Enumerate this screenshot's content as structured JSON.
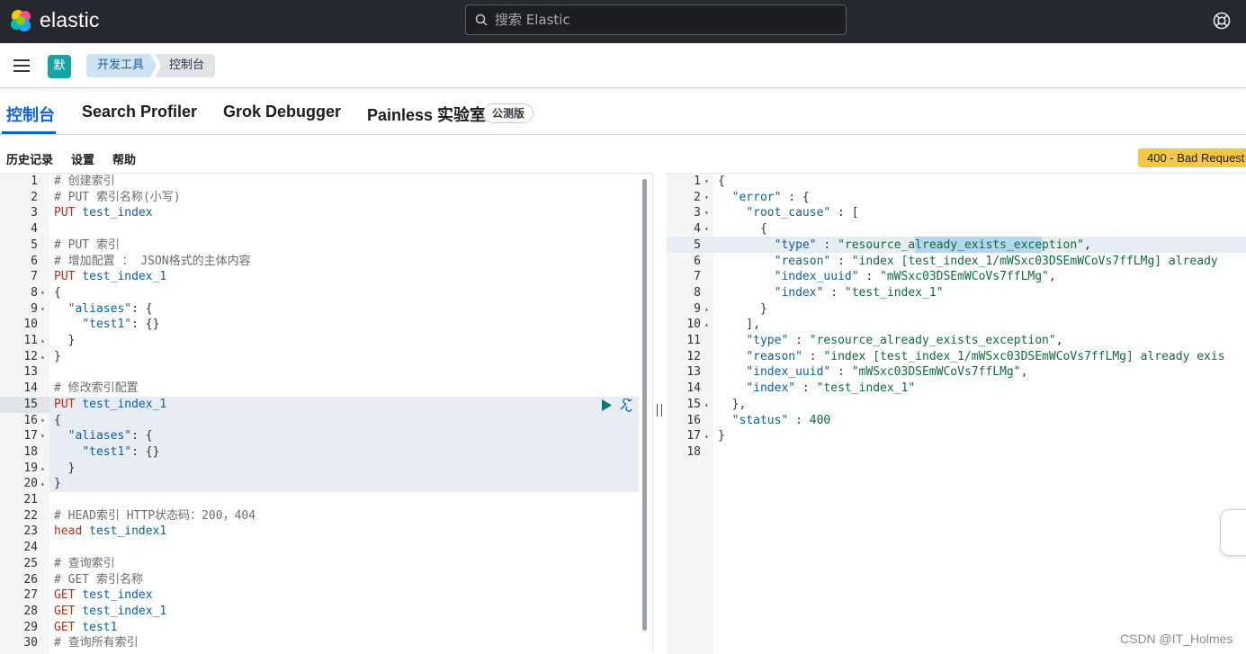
{
  "header": {
    "brand": "elastic",
    "search_placeholder": "搜索 Elastic"
  },
  "subbar": {
    "space_avatar": "默",
    "breadcrumbs": [
      "开发工具",
      "控制台"
    ]
  },
  "tabs": [
    {
      "label": "控制台"
    },
    {
      "label": "Search Profiler"
    },
    {
      "label": "Grok Debugger"
    },
    {
      "label": "Painless 实验室"
    }
  ],
  "beta_badge": "公测版",
  "toolbar": {
    "history": "历史记录",
    "settings": "设置",
    "help": "帮助"
  },
  "status": "400 - Bad Request",
  "editor_lines": [
    {
      "n": "1",
      "f": "",
      "parts": [
        [
          "c",
          "# 创建索引"
        ]
      ]
    },
    {
      "n": "2",
      "f": "",
      "parts": [
        [
          "c",
          "# PUT 索引名称(小写)"
        ]
      ]
    },
    {
      "n": "3",
      "f": "",
      "parts": [
        [
          "m",
          "PUT"
        ],
        [
          "t",
          " test_index"
        ]
      ]
    },
    {
      "n": "4",
      "f": "",
      "parts": []
    },
    {
      "n": "5",
      "f": "",
      "parts": [
        [
          "c",
          "# PUT 索引"
        ]
      ]
    },
    {
      "n": "6",
      "f": "",
      "parts": [
        [
          "c",
          "# 增加配置 ： JSON格式的主体内容"
        ]
      ]
    },
    {
      "n": "7",
      "f": "",
      "parts": [
        [
          "m",
          "PUT"
        ],
        [
          "t",
          " test_index_1"
        ]
      ]
    },
    {
      "n": "8",
      "f": "▾",
      "parts": [
        [
          "p",
          "{"
        ]
      ]
    },
    {
      "n": "9",
      "f": "▾",
      "parts": [
        [
          "p",
          "  "
        ],
        [
          "k",
          "\"aliases\""
        ],
        [
          "p",
          ": {"
        ]
      ]
    },
    {
      "n": "10",
      "f": "",
      "parts": [
        [
          "p",
          "    "
        ],
        [
          "k",
          "\"test1\""
        ],
        [
          "p",
          ": {}"
        ]
      ]
    },
    {
      "n": "11",
      "f": "▴",
      "parts": [
        [
          "p",
          "  }"
        ]
      ]
    },
    {
      "n": "12",
      "f": "▴",
      "parts": [
        [
          "p",
          "}"
        ]
      ]
    },
    {
      "n": "13",
      "f": "",
      "parts": []
    },
    {
      "n": "14",
      "f": "",
      "parts": [
        [
          "c",
          "# 修改索引配置"
        ]
      ]
    },
    {
      "n": "15",
      "f": "",
      "parts": [
        [
          "m",
          "PUT"
        ],
        [
          "t",
          " test_index_1"
        ]
      ]
    },
    {
      "n": "16",
      "f": "▾",
      "parts": [
        [
          "p",
          "{"
        ]
      ]
    },
    {
      "n": "17",
      "f": "▾",
      "parts": [
        [
          "p",
          "  "
        ],
        [
          "k",
          "\"aliases\""
        ],
        [
          "p",
          ": {"
        ]
      ]
    },
    {
      "n": "18",
      "f": "",
      "parts": [
        [
          "p",
          "    "
        ],
        [
          "k",
          "\"test1\""
        ],
        [
          "p",
          ": {}"
        ]
      ]
    },
    {
      "n": "19",
      "f": "▴",
      "parts": [
        [
          "p",
          "  }"
        ]
      ]
    },
    {
      "n": "20",
      "f": "▴",
      "parts": [
        [
          "p",
          "}"
        ]
      ]
    },
    {
      "n": "21",
      "f": "",
      "parts": []
    },
    {
      "n": "22",
      "f": "",
      "parts": [
        [
          "c",
          "# HEAD索引 HTTP状态码：200，404"
        ]
      ]
    },
    {
      "n": "23",
      "f": "",
      "parts": [
        [
          "m",
          "head"
        ],
        [
          "t",
          " test_index1"
        ]
      ]
    },
    {
      "n": "24",
      "f": "",
      "parts": []
    },
    {
      "n": "25",
      "f": "",
      "parts": [
        [
          "c",
          "# 查询索引"
        ]
      ]
    },
    {
      "n": "26",
      "f": "",
      "parts": [
        [
          "c",
          "# GET 索引名称"
        ]
      ]
    },
    {
      "n": "27",
      "f": "",
      "parts": [
        [
          "m",
          "GET"
        ],
        [
          "t",
          " test_index"
        ]
      ]
    },
    {
      "n": "28",
      "f": "",
      "parts": [
        [
          "m",
          "GET"
        ],
        [
          "t",
          " test_index_1"
        ]
      ]
    },
    {
      "n": "29",
      "f": "",
      "parts": [
        [
          "m",
          "GET"
        ],
        [
          "t",
          " test1"
        ]
      ]
    },
    {
      "n": "30",
      "f": "",
      "parts": [
        [
          "c",
          "# 查询所有索引"
        ]
      ]
    }
  ],
  "output_lines": [
    {
      "n": "1",
      "f": "▾",
      "parts": [
        [
          "p",
          "{"
        ]
      ]
    },
    {
      "n": "2",
      "f": "▾",
      "parts": [
        [
          "p",
          "  "
        ],
        [
          "k",
          "\"error\""
        ],
        [
          "p",
          " : {"
        ]
      ]
    },
    {
      "n": "3",
      "f": "▾",
      "parts": [
        [
          "p",
          "    "
        ],
        [
          "k",
          "\"root_cause\""
        ],
        [
          "p",
          " : ["
        ]
      ]
    },
    {
      "n": "4",
      "f": "▾",
      "parts": [
        [
          "p",
          "      {"
        ]
      ]
    },
    {
      "n": "5",
      "f": "",
      "parts": [
        [
          "p",
          "        "
        ],
        [
          "k",
          "\"type\""
        ],
        [
          "p",
          " : "
        ],
        [
          "s",
          "\"resource_already_exists_exception\""
        ],
        [
          "p",
          ","
        ]
      ]
    },
    {
      "n": "6",
      "f": "",
      "parts": [
        [
          "p",
          "        "
        ],
        [
          "k",
          "\"reason\""
        ],
        [
          "p",
          " : "
        ],
        [
          "s",
          "\"index [test_index_1/mWSxc03DSEmWCoVs7ffLMg] already"
        ]
      ]
    },
    {
      "n": "7",
      "f": "",
      "parts": [
        [
          "p",
          "        "
        ],
        [
          "k",
          "\"index_uuid\""
        ],
        [
          "p",
          " : "
        ],
        [
          "s",
          "\"mWSxc03DSEmWCoVs7ffLMg\""
        ],
        [
          "p",
          ","
        ]
      ]
    },
    {
      "n": "8",
      "f": "",
      "parts": [
        [
          "p",
          "        "
        ],
        [
          "k",
          "\"index\""
        ],
        [
          "p",
          " : "
        ],
        [
          "s",
          "\"test_index_1\""
        ]
      ]
    },
    {
      "n": "9",
      "f": "▴",
      "parts": [
        [
          "p",
          "      }"
        ]
      ]
    },
    {
      "n": "10",
      "f": "▴",
      "parts": [
        [
          "p",
          "    ],"
        ]
      ]
    },
    {
      "n": "11",
      "f": "",
      "parts": [
        [
          "p",
          "    "
        ],
        [
          "k",
          "\"type\""
        ],
        [
          "p",
          " : "
        ],
        [
          "s",
          "\"resource_already_exists_exception\""
        ],
        [
          "p",
          ","
        ]
      ]
    },
    {
      "n": "12",
      "f": "",
      "parts": [
        [
          "p",
          "    "
        ],
        [
          "k",
          "\"reason\""
        ],
        [
          "p",
          " : "
        ],
        [
          "s",
          "\"index [test_index_1/mWSxc03DSEmWCoVs7ffLMg] already exis"
        ]
      ]
    },
    {
      "n": "13",
      "f": "",
      "parts": [
        [
          "p",
          "    "
        ],
        [
          "k",
          "\"index_uuid\""
        ],
        [
          "p",
          " : "
        ],
        [
          "s",
          "\"mWSxc03DSEmWCoVs7ffLMg\""
        ],
        [
          "p",
          ","
        ]
      ]
    },
    {
      "n": "14",
      "f": "",
      "parts": [
        [
          "p",
          "    "
        ],
        [
          "k",
          "\"index\""
        ],
        [
          "p",
          " : "
        ],
        [
          "s",
          "\"test_index_1\""
        ]
      ]
    },
    {
      "n": "15",
      "f": "▴",
      "parts": [
        [
          "p",
          "  },"
        ]
      ]
    },
    {
      "n": "16",
      "f": "",
      "parts": [
        [
          "p",
          "  "
        ],
        [
          "k",
          "\"status\""
        ],
        [
          "p",
          " : "
        ],
        [
          "n",
          "400"
        ]
      ]
    },
    {
      "n": "17",
      "f": "▴",
      "parts": [
        [
          "p",
          "}"
        ]
      ]
    },
    {
      "n": "18",
      "f": "",
      "parts": []
    }
  ],
  "watermark": "CSDN @IT_Holmes"
}
